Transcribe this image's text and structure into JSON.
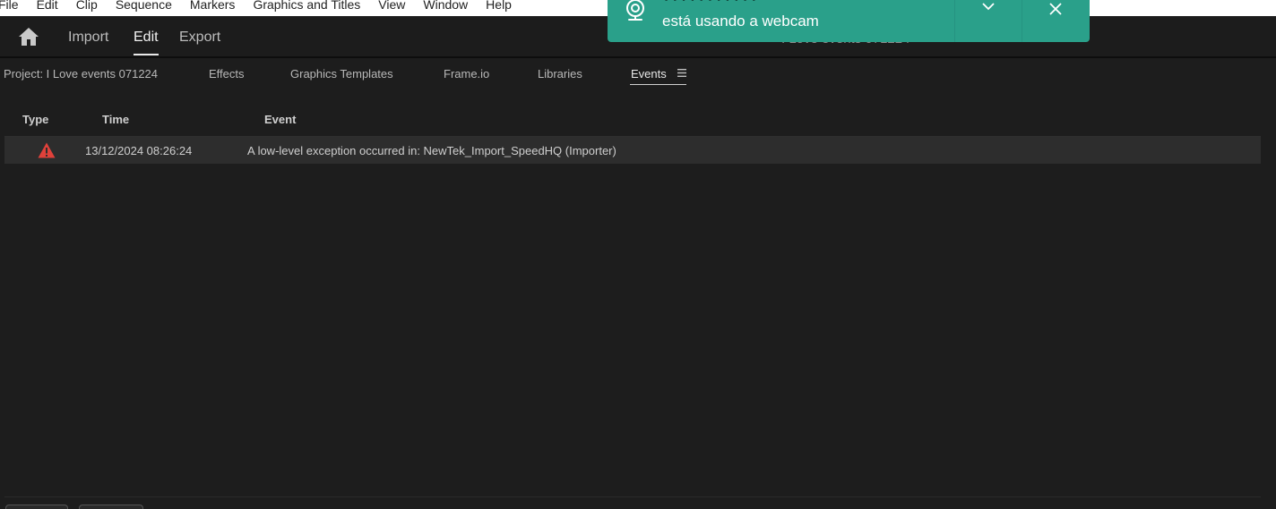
{
  "menubar": {
    "items": [
      "File",
      "Edit",
      "Clip",
      "Sequence",
      "Markers",
      "Graphics and Titles",
      "View",
      "Window",
      "Help"
    ]
  },
  "header": {
    "tabs": {
      "import": "Import",
      "edit": "Edit",
      "export": "Export"
    },
    "active_tab": "Edit",
    "project_title": "I Love events 071224"
  },
  "panels": {
    "project": "Project: I Love events 071224",
    "effects": "Effects",
    "graphics_templates": "Graphics Templates",
    "frameio": "Frame.io",
    "libraries": "Libraries",
    "events": "Events",
    "active": "Events"
  },
  "events_table": {
    "columns": {
      "type": "Type",
      "time": "Time",
      "event": "Event"
    },
    "rows": [
      {
        "type_icon": "warning-icon",
        "time": "13/12/2024 08:26:24",
        "event": "A low-level exception occurred in: NewTek_Import_SpeedHQ (Importer)"
      }
    ]
  },
  "notification": {
    "app_name": "???????????",
    "message": "está usando a webcam",
    "icon": "webcam-icon"
  },
  "colors": {
    "toast": "#2aa08a",
    "warning": "#e0413a",
    "background": "#1d1d1d"
  }
}
